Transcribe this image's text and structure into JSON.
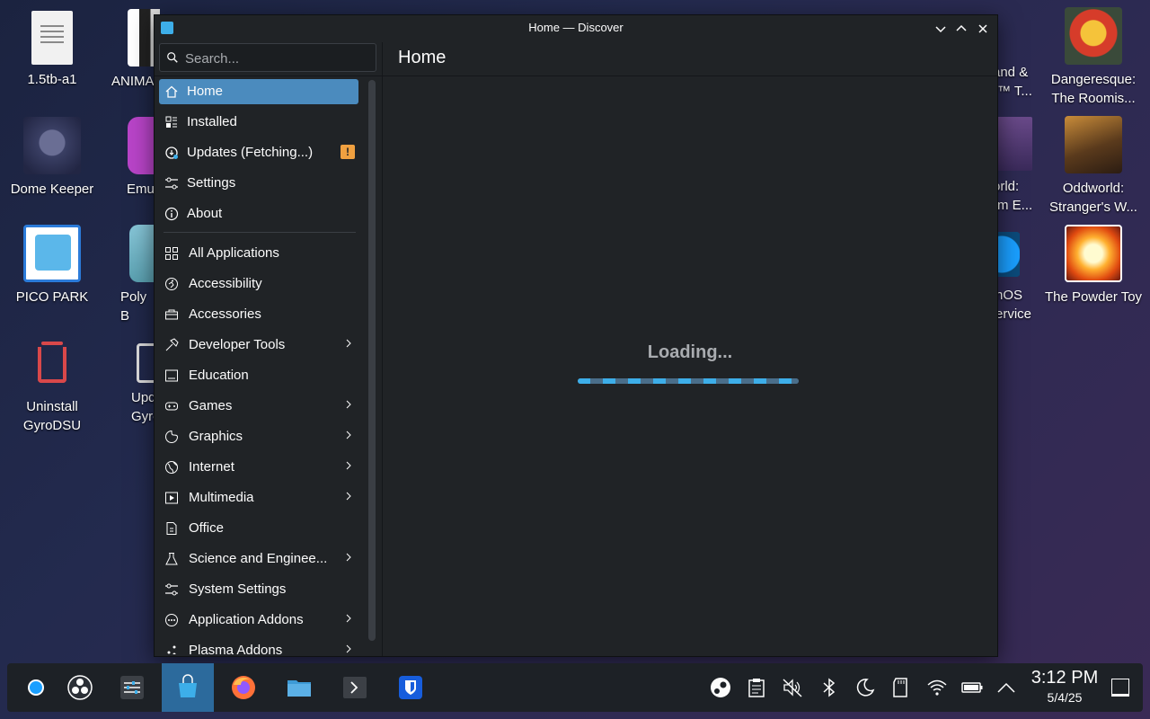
{
  "desktop": {
    "icons": [
      {
        "label": "1.5tb-a1"
      },
      {
        "label": "ANIMA"
      },
      {
        "label": "Dome Keeper"
      },
      {
        "label": "Emu"
      },
      {
        "label": "PICO PARK"
      },
      {
        "label": "Poly B"
      },
      {
        "label": "Uninstall GyroDSU"
      },
      {
        "label": "Upd Gyro"
      },
      {
        "label": "Dangeresque: The Roomis..."
      },
      {
        "label": "Oddworld: Stranger's W..."
      },
      {
        "label": "The Powder Toy"
      },
      {
        "label": "and & r™ T..."
      },
      {
        "label": "orld: rm E..."
      },
      {
        "label": "nOS ervice"
      }
    ]
  },
  "window": {
    "title": "Home — Discover",
    "search_placeholder": "Search...",
    "page_title": "Home",
    "nav": [
      {
        "label": "Home",
        "icon": "home-icon",
        "active": true
      },
      {
        "label": "Installed",
        "icon": "installed-icon"
      },
      {
        "label": "Updates (Fetching...)",
        "icon": "updates-icon",
        "badge": "!"
      },
      {
        "label": "Settings",
        "icon": "settings-icon"
      },
      {
        "label": "About",
        "icon": "info-icon"
      }
    ],
    "categories": [
      {
        "label": "All Applications",
        "icon": "grid-icon",
        "submenu": false
      },
      {
        "label": "Accessibility",
        "icon": "accessibility-icon",
        "submenu": false
      },
      {
        "label": "Accessories",
        "icon": "toolbox-icon",
        "submenu": false
      },
      {
        "label": "Developer Tools",
        "icon": "hammer-icon",
        "submenu": true
      },
      {
        "label": "Education",
        "icon": "education-icon",
        "submenu": false
      },
      {
        "label": "Games",
        "icon": "gamepad-icon",
        "submenu": true
      },
      {
        "label": "Graphics",
        "icon": "palette-icon",
        "submenu": true
      },
      {
        "label": "Internet",
        "icon": "globe-icon",
        "submenu": true
      },
      {
        "label": "Multimedia",
        "icon": "multimedia-icon",
        "submenu": true
      },
      {
        "label": "Office",
        "icon": "document-icon",
        "submenu": false
      },
      {
        "label": "Science and Enginee...",
        "icon": "flask-icon",
        "submenu": true
      },
      {
        "label": "System Settings",
        "icon": "sliders-icon",
        "submenu": false
      },
      {
        "label": "Application Addons",
        "icon": "addons-icon",
        "submenu": true
      },
      {
        "label": "Plasma Addons",
        "icon": "plasma-icon",
        "submenu": true
      }
    ],
    "loading_text": "Loading...",
    "progress": 1.0
  },
  "taskbar": {
    "time": "3:12 PM",
    "date": "5/4/25",
    "apps": [
      "steamos-menu-icon",
      "obs-icon",
      "mixer-icon",
      "discover-icon",
      "firefox-icon",
      "files-icon",
      "terminal-icon",
      "bitwarden-icon"
    ],
    "tray": [
      "steam-icon",
      "clipboard-icon",
      "volume-muted-icon",
      "bluetooth-icon",
      "night-light-icon",
      "sd-card-icon",
      "wifi-icon",
      "battery-icon",
      "expand-tray-icon"
    ]
  },
  "colors": {
    "accent": "#3daee9",
    "selection": "#4b8bbe",
    "warning": "#f0a040",
    "window_bg": "#202326"
  }
}
